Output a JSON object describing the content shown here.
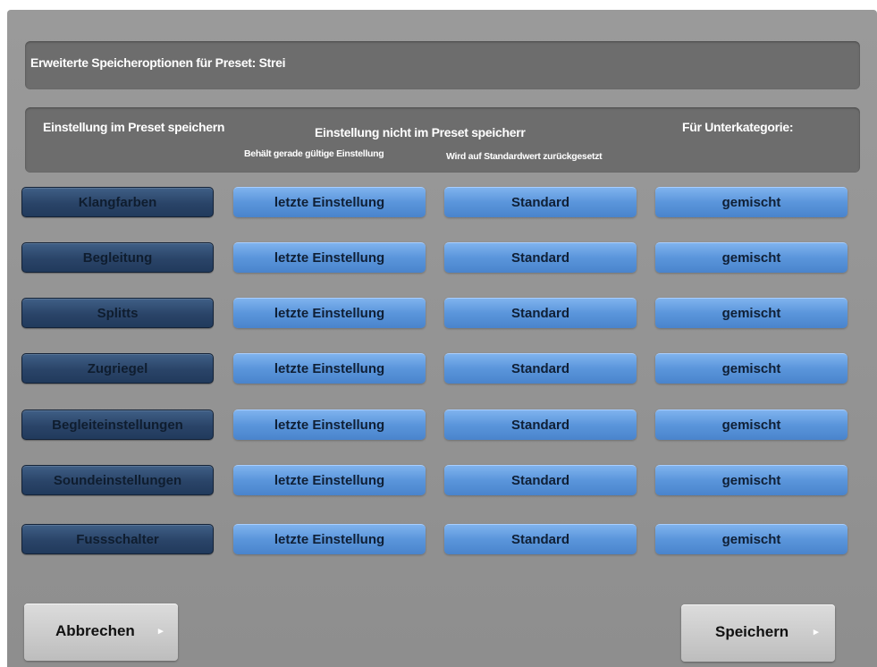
{
  "dialog": {
    "title": "Erweiterte Speicheroptionen für Preset: Strei"
  },
  "headers": {
    "save_in_preset": "Einstellung im Preset speichern",
    "not_in_preset": "Einstellung nicht im Preset speicherr",
    "keeps_current": "Behält gerade gültige Einstellung",
    "reset_default": "Wird auf Standardwert zurückgesetzt",
    "subcategory": "Für Unterkategorie:"
  },
  "rows": [
    {
      "name": "Klangfarben",
      "last": "letzte Einstellung",
      "standard": "Standard",
      "sub": "gemischt"
    },
    {
      "name": "Begleitung",
      "last": "letzte Einstellung",
      "standard": "Standard",
      "sub": "gemischt"
    },
    {
      "name": "Splitts",
      "last": "letzte Einstellung",
      "standard": "Standard",
      "sub": "gemischt"
    },
    {
      "name": "Zugriegel",
      "last": "letzte Einstellung",
      "standard": "Standard",
      "sub": "gemischt"
    },
    {
      "name": "Begleiteinstellungen",
      "last": "letzte Einstellung",
      "standard": "Standard",
      "sub": "gemischt"
    },
    {
      "name": "Soundeinstellungen",
      "last": "letzte Einstellung",
      "standard": "Standard",
      "sub": "gemischt"
    },
    {
      "name": "Fussschalter",
      "last": "letzte Einstellung",
      "standard": "Standard",
      "sub": "gemischt"
    }
  ],
  "buttons": {
    "cancel": "Abbrechen",
    "save": "Speichern",
    "arrow_icon": "▸"
  },
  "colors": {
    "selected_dark_blue": "#2a4468",
    "option_light_blue": "#5a95db",
    "panel_gray": "#949494"
  }
}
